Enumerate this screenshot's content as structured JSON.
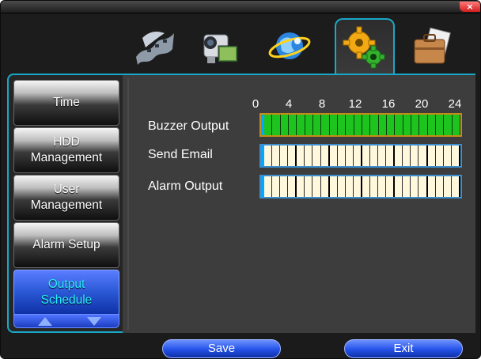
{
  "window": {
    "close_glyph": "×"
  },
  "tabs": [
    {
      "icon": "film-reel-icon"
    },
    {
      "icon": "camcorder-icon"
    },
    {
      "icon": "globe-network-icon"
    },
    {
      "icon": "gears-icon",
      "active": true
    },
    {
      "icon": "briefcase-icon"
    }
  ],
  "sidebar": {
    "items": [
      {
        "lines": [
          "Time"
        ]
      },
      {
        "lines": [
          "HDD",
          "Management"
        ]
      },
      {
        "lines": [
          "User",
          "Management"
        ]
      },
      {
        "lines": [
          "Alarm Setup"
        ]
      },
      {
        "lines": [
          "Output",
          "Schedule"
        ],
        "active": true
      }
    ]
  },
  "schedule": {
    "ticks": [
      "0",
      "4",
      "8",
      "12",
      "16",
      "20",
      "24"
    ],
    "rows": [
      {
        "label": "Buzzer Output",
        "enabled_hours": 24
      },
      {
        "label": "Send Email",
        "enabled_hours": 0
      },
      {
        "label": "Alarm Output",
        "enabled_hours": 0
      }
    ]
  },
  "buttons": {
    "save": "Save",
    "exit": "Exit"
  },
  "colors": {
    "accent": "#1aa8c8",
    "active_blue": "#2d5bd8",
    "active_text": "#28f0ff",
    "enabled_slot": "#1ec41e",
    "disabled_slot": "#fff8dc"
  }
}
